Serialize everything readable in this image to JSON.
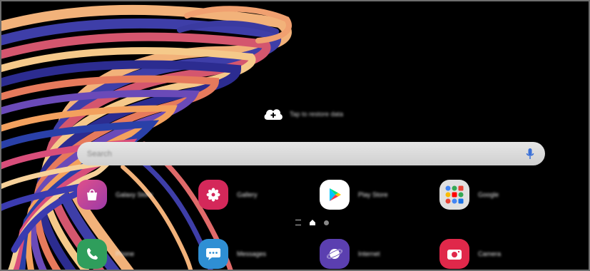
{
  "colors": {
    "background": "#000000",
    "search_bar": "#dcdcdc",
    "galaxy_store": "#c8437e",
    "gallery": "#d4285a",
    "play_store": "#ffffff",
    "google_folder": "#e0e0e0",
    "phone": "#2f9e5c",
    "messages": "#2f8fd4",
    "internet": "#5b3fb0",
    "camera": "#e0284a"
  },
  "widget": {
    "cloud_text": "Tap to restore data",
    "icon": "cloud-upload-icon"
  },
  "search": {
    "placeholder": "Search",
    "mic_icon": "microphone-icon"
  },
  "apps_row1": [
    {
      "label": "Galaxy Store",
      "icon": "shopping-bag-icon"
    },
    {
      "label": "Gallery",
      "icon": "flower-icon"
    },
    {
      "label": "Play Store",
      "icon": "play-triangle-icon"
    },
    {
      "label": "Google",
      "icon": "folder-icon"
    }
  ],
  "apps_row2": [
    {
      "label": "Phone",
      "icon": "phone-icon"
    },
    {
      "label": "Messages",
      "icon": "chat-bubble-icon"
    },
    {
      "label": "Internet",
      "icon": "planet-icon"
    },
    {
      "label": "Camera",
      "icon": "camera-icon"
    }
  ],
  "page_indicator": {
    "pages": [
      "menu",
      "home",
      "page"
    ]
  }
}
